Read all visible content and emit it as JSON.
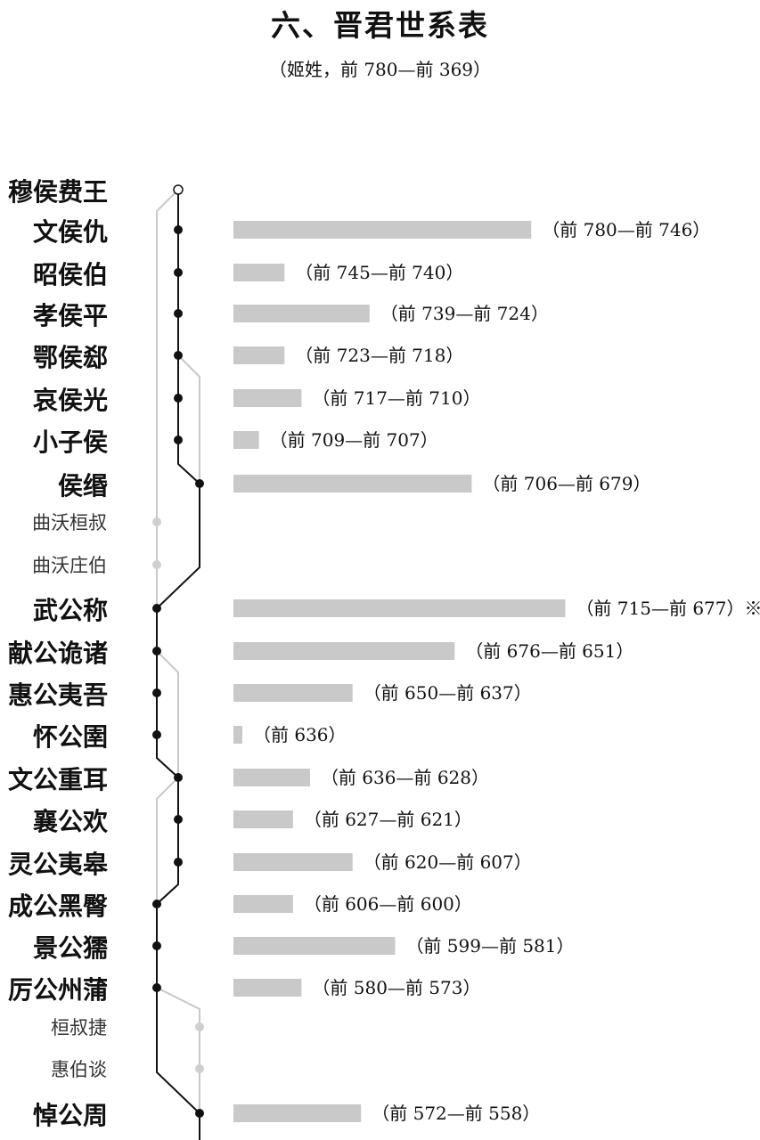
{
  "header": {
    "title": "六、晋君世系表",
    "subtitle": "（姬姓，前 780—前 369）"
  },
  "chart_data": {
    "type": "bar",
    "title": "六、晋君世系表",
    "subtitle": "（姬姓，前 780—前 369）",
    "colors": {
      "bar": "#c9c9c9",
      "ruler_line": "#111111",
      "non_ruler_line": "#c8c8c8"
    },
    "rows": [
      {
        "name": "穆侯费王",
        "kind": "ruler",
        "lineage": 0,
        "dot": "open",
        "start": null,
        "end": null,
        "label": ""
      },
      {
        "name": "文侯仇",
        "kind": "ruler",
        "lineage": 0,
        "dot": "filled",
        "start": 780,
        "end": 746,
        "label": "（前 780—前 746）"
      },
      {
        "name": "昭侯伯",
        "kind": "ruler",
        "lineage": 0,
        "dot": "filled",
        "start": 745,
        "end": 740,
        "label": "（前 745—前 740）"
      },
      {
        "name": "孝侯平",
        "kind": "ruler",
        "lineage": 0,
        "dot": "filled",
        "start": 739,
        "end": 724,
        "label": "（前 739—前 724）"
      },
      {
        "name": "鄂侯郄",
        "kind": "ruler",
        "lineage": 0,
        "dot": "filled",
        "start": 723,
        "end": 718,
        "label": "（前 723—前 718）"
      },
      {
        "name": "哀侯光",
        "kind": "ruler",
        "lineage": 0,
        "dot": "filled",
        "start": 717,
        "end": 710,
        "label": "（前 717—前 710）"
      },
      {
        "name": "小子侯",
        "kind": "ruler",
        "lineage": 0,
        "dot": "filled",
        "start": 709,
        "end": 707,
        "label": "（前 709—前 707）"
      },
      {
        "name": "侯缗",
        "kind": "ruler",
        "lineage": 1,
        "dot": "filled",
        "start": 706,
        "end": 679,
        "label": "（前 706—前 679）"
      },
      {
        "name": "曲沃桓叔",
        "kind": "other",
        "lineage": -1,
        "dot": "gray",
        "start": null,
        "end": null,
        "label": ""
      },
      {
        "name": "曲沃庄伯",
        "kind": "other",
        "lineage": -1,
        "dot": "gray",
        "start": null,
        "end": null,
        "label": ""
      },
      {
        "name": "武公称",
        "kind": "ruler",
        "lineage": -1,
        "dot": "filled",
        "start": 715,
        "end": 677,
        "label": "（前 715—前 677）※"
      },
      {
        "name": "献公诡诸",
        "kind": "ruler",
        "lineage": -1,
        "dot": "filled",
        "start": 676,
        "end": 651,
        "label": "（前 676—前 651）"
      },
      {
        "name": "惠公夷吾",
        "kind": "ruler",
        "lineage": -1,
        "dot": "filled",
        "start": 650,
        "end": 637,
        "label": "（前 650—前 637）"
      },
      {
        "name": "怀公圉",
        "kind": "ruler",
        "lineage": -1,
        "dot": "filled",
        "start": 636,
        "end": 636,
        "label": "（前 636）"
      },
      {
        "name": "文公重耳",
        "kind": "ruler",
        "lineage": 0,
        "dot": "filled",
        "start": 636,
        "end": 628,
        "label": "（前 636—前 628）"
      },
      {
        "name": "襄公欢",
        "kind": "ruler",
        "lineage": 0,
        "dot": "filled",
        "start": 627,
        "end": 621,
        "label": "（前 627—前 621）"
      },
      {
        "name": "灵公夷皋",
        "kind": "ruler",
        "lineage": 0,
        "dot": "filled",
        "start": 620,
        "end": 607,
        "label": "（前 620—前 607）"
      },
      {
        "name": "成公黑臀",
        "kind": "ruler",
        "lineage": -1,
        "dot": "filled",
        "start": 606,
        "end": 600,
        "label": "（前 606—前 600）"
      },
      {
        "name": "景公獳",
        "kind": "ruler",
        "lineage": -1,
        "dot": "filled",
        "start": 599,
        "end": 581,
        "label": "（前 599—前 581）"
      },
      {
        "name": "厉公州蒲",
        "kind": "ruler",
        "lineage": -1,
        "dot": "filled",
        "start": 580,
        "end": 573,
        "label": "（前 580—前 573）"
      },
      {
        "name": "桓叔捷",
        "kind": "other",
        "lineage": 1,
        "dot": "gray",
        "start": null,
        "end": null,
        "label": ""
      },
      {
        "name": "惠伯谈",
        "kind": "other",
        "lineage": 1,
        "dot": "gray",
        "start": null,
        "end": null,
        "label": ""
      },
      {
        "name": "悼公周",
        "kind": "ruler",
        "lineage": 1,
        "dot": "filled",
        "start": 572,
        "end": 558,
        "label": "（前 572—前 558）"
      }
    ],
    "ruler_path": [
      0,
      1,
      2,
      3,
      4,
      5,
      6,
      7,
      10,
      11,
      12,
      13,
      14,
      15,
      16,
      17,
      18,
      19,
      22
    ],
    "non_ruler_links": [
      [
        0,
        8
      ],
      [
        4,
        7
      ],
      [
        11,
        14
      ],
      [
        14,
        17
      ],
      [
        19,
        22
      ],
      [
        8,
        9
      ],
      [
        9,
        10
      ]
    ]
  }
}
